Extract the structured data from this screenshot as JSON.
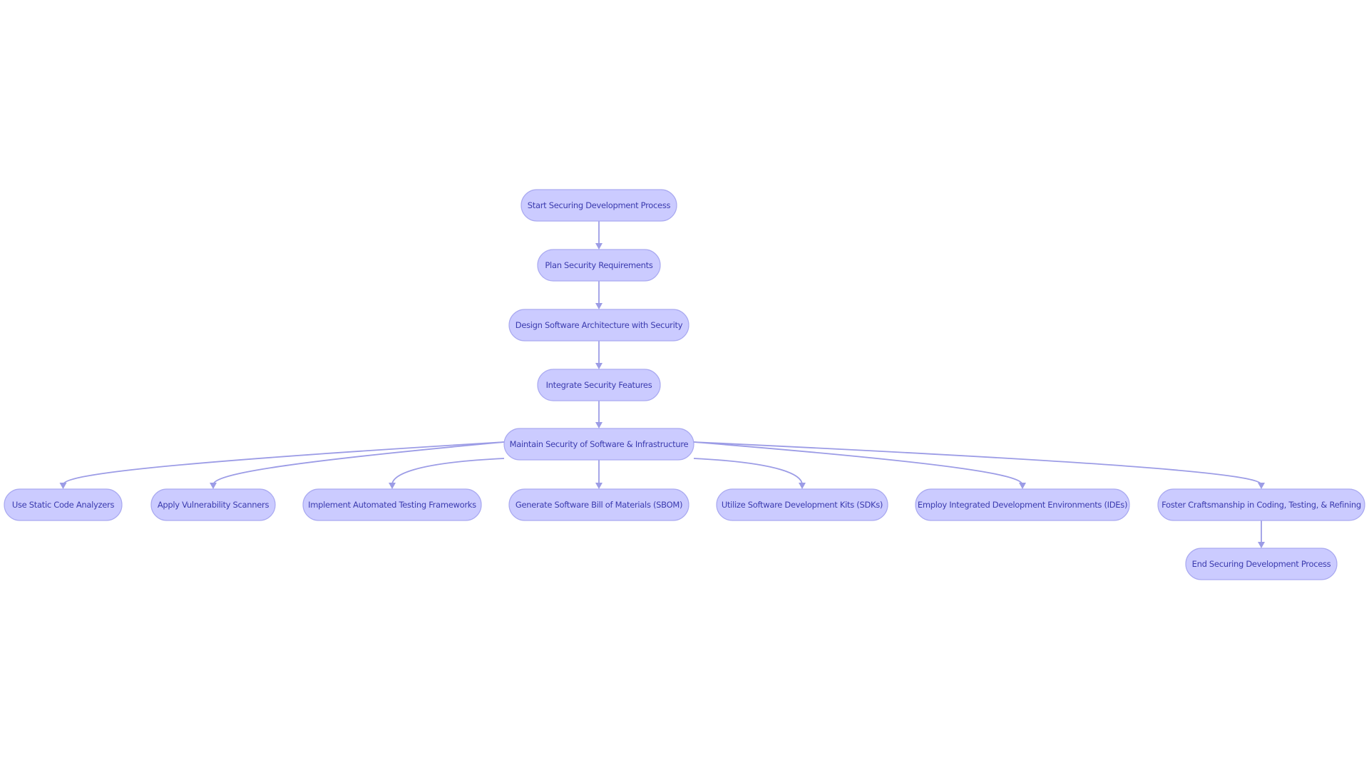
{
  "diagram": {
    "type": "flowchart",
    "colors": {
      "node_fill": "#cbcbff",
      "node_stroke": "#a9a9f0",
      "text": "#3b3bae",
      "edge": "#9c9ce6"
    },
    "nodes": [
      {
        "id": "start",
        "label": "Start Securing Development Process"
      },
      {
        "id": "plan",
        "label": "Plan Security Requirements"
      },
      {
        "id": "design",
        "label": "Design Software Architecture with Security"
      },
      {
        "id": "integrate",
        "label": "Integrate Security Features"
      },
      {
        "id": "maintain",
        "label": "Maintain Security of Software & Infrastructure"
      },
      {
        "id": "static",
        "label": "Use Static Code Analyzers"
      },
      {
        "id": "vuln",
        "label": "Apply Vulnerability Scanners"
      },
      {
        "id": "testing",
        "label": "Implement Automated Testing Frameworks"
      },
      {
        "id": "sbom",
        "label": "Generate Software Bill of Materials (SBOM)"
      },
      {
        "id": "sdk",
        "label": "Utilize Software Development Kits (SDKs)"
      },
      {
        "id": "ide",
        "label": "Employ Integrated Development Environments (IDEs)"
      },
      {
        "id": "craft",
        "label": "Foster Craftsmanship in Coding, Testing, & Refining"
      },
      {
        "id": "end",
        "label": "End Securing Development Process"
      }
    ],
    "edges": [
      {
        "from": "start",
        "to": "plan"
      },
      {
        "from": "plan",
        "to": "design"
      },
      {
        "from": "design",
        "to": "integrate"
      },
      {
        "from": "integrate",
        "to": "maintain"
      },
      {
        "from": "maintain",
        "to": "static"
      },
      {
        "from": "maintain",
        "to": "vuln"
      },
      {
        "from": "maintain",
        "to": "testing"
      },
      {
        "from": "maintain",
        "to": "sbom"
      },
      {
        "from": "maintain",
        "to": "sdk"
      },
      {
        "from": "maintain",
        "to": "ide"
      },
      {
        "from": "maintain",
        "to": "craft"
      },
      {
        "from": "craft",
        "to": "end"
      }
    ]
  }
}
